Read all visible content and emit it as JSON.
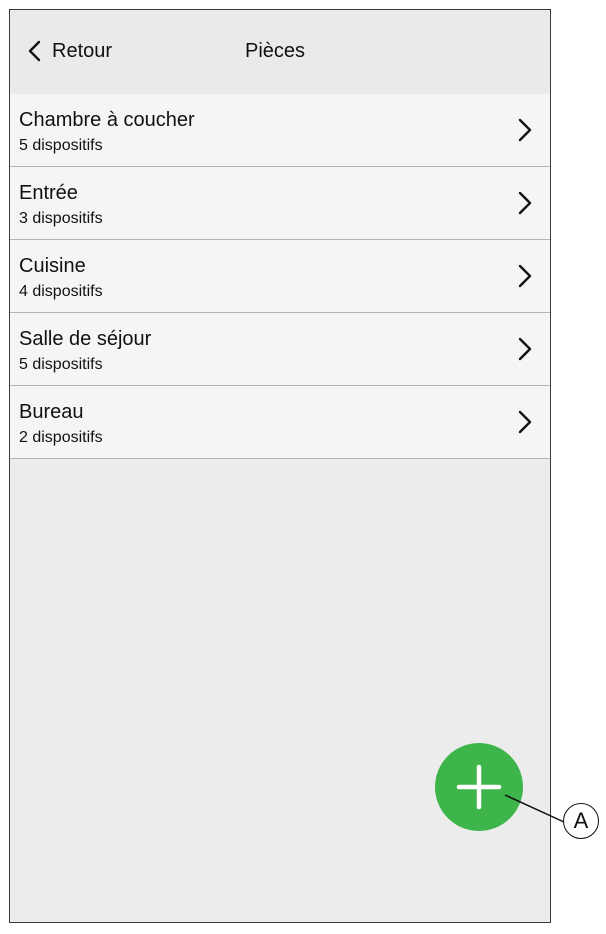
{
  "header": {
    "back_label": "Retour",
    "title": "Pièces"
  },
  "rooms": [
    {
      "name": "Chambre à coucher",
      "count": "5 dispositifs"
    },
    {
      "name": "Entrée",
      "count": "3 dispositifs"
    },
    {
      "name": "Cuisine",
      "count": "4 dispositifs"
    },
    {
      "name": "Salle de séjour",
      "count": "5 dispositifs"
    },
    {
      "name": "Bureau",
      "count": "2 dispositifs"
    }
  ],
  "fab": {
    "icon": "plus-icon",
    "color": "#3db54a"
  },
  "callout": {
    "label": "A"
  },
  "icons": {
    "back": "chevron-left-icon",
    "row": "chevron-right-icon"
  }
}
